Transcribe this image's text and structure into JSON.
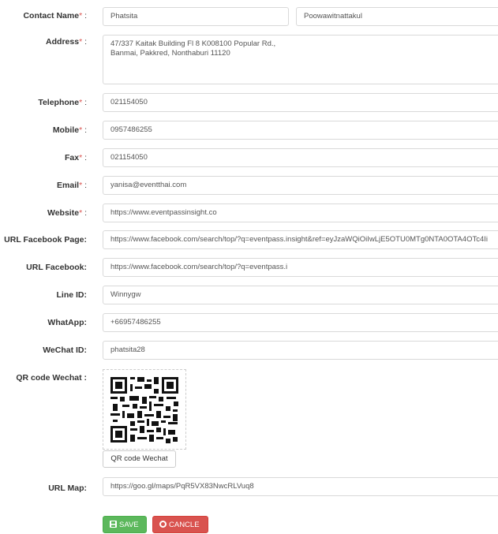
{
  "form": {
    "contact_name": {
      "label": "Contact Name",
      "first": "Phatsita",
      "last": "Poowawitnattakul"
    },
    "address": {
      "label": "Address",
      "line1": "47/337 Kaitak Building Fl 8 K008100 Popular Rd.,",
      "line2": "Banmai, Pakkred, Nonthaburi 11120"
    },
    "telephone": {
      "label": "Telephone",
      "value": "021154050"
    },
    "mobile": {
      "label": "Mobile",
      "value": "0957486255"
    },
    "fax": {
      "label": "Fax",
      "value": "021154050"
    },
    "email": {
      "label": "Email",
      "value": "yanisa@eventthai.com"
    },
    "website": {
      "label": "Website",
      "value": "https://www.eventpassinsight.co"
    },
    "url_facebook_page": {
      "label": "URL Facebook Page:",
      "value": "https://www.facebook.com/search/top/?q=eventpass.insight&ref=eyJzaWQiOiIwLjE5OTU0MTg0NTA0OTA4OTc4Ii"
    },
    "url_facebook": {
      "label": "URL Facebook:",
      "value": "https://www.facebook.com/search/top/?q=eventpass.i"
    },
    "line_id": {
      "label": "Line ID:",
      "value": "Winnygw"
    },
    "whatapp": {
      "label": "WhatApp:",
      "value": "+66957486255"
    },
    "wechat_id": {
      "label": "WeChat ID:",
      "value": "phatsita28"
    },
    "qr_code": {
      "label": "QR code Wechat :",
      "button": "QR code Wechat"
    },
    "url_map": {
      "label": "URL Map:",
      "value": "https://goo.gl/maps/PqR5VX83NwcRLVuq8"
    }
  },
  "required_mark": "*",
  "colon": " :",
  "buttons": {
    "save": "SAVE",
    "cancel": "CANCLE"
  },
  "colors": {
    "required": "#d9534f",
    "save": "#5cb85c",
    "cancel": "#d9534f"
  },
  "icons": {
    "save": "save-icon",
    "cancel": "cancel-circle-icon",
    "qr": "qr-code-image"
  }
}
